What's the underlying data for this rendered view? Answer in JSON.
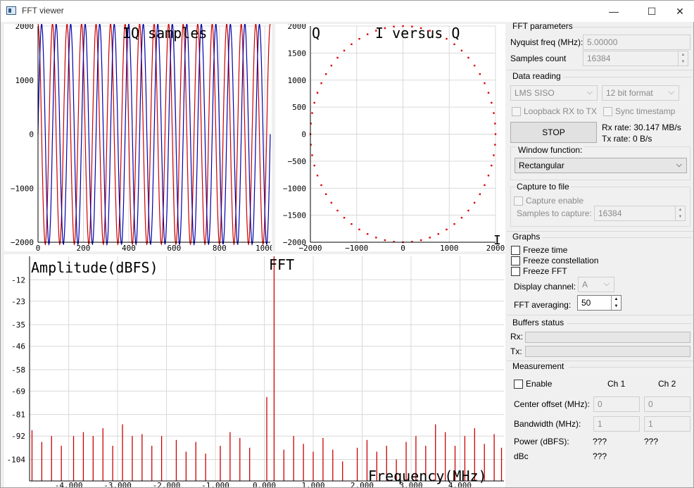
{
  "window": {
    "title": "FFT viewer",
    "minimize_glyph": "—",
    "maximize_glyph": "☐",
    "close_glyph": "✕"
  },
  "iq_plot": {
    "title": "IQ samples",
    "y_ticks": [
      "2000",
      "1000",
      "0",
      "−1000",
      "−2000"
    ],
    "x_ticks": [
      "0",
      "200",
      "400",
      "600",
      "800",
      "1000"
    ],
    "colors": {
      "i": "#cc0000",
      "q": "#0000aa"
    },
    "chart_data": {
      "type": "line",
      "title": "IQ samples",
      "xlim": [
        0,
        1024
      ],
      "ylim": [
        -2000,
        2000
      ],
      "cycles": 16,
      "amplitude": 2000,
      "series": [
        {
          "name": "I",
          "color": "#cc0000"
        },
        {
          "name": "Q",
          "color": "#0000aa"
        }
      ]
    }
  },
  "const_plot": {
    "title": "I versus Q",
    "corner_label": "Q",
    "x_end_label": "I",
    "y_ticks": [
      "2000",
      "1500",
      "1000",
      "500",
      "0",
      "−500",
      "−1000",
      "−1500",
      "−2000"
    ],
    "x_ticks": [
      "−2000",
      "−1000",
      "0",
      "1000",
      "2000"
    ],
    "color": "#dd0000",
    "chart_data": {
      "type": "scatter",
      "title": "I versus Q",
      "xlim": [
        -2000,
        2000
      ],
      "ylim": [
        -2000,
        2000
      ],
      "radius": 2000,
      "points": 64
    }
  },
  "fft_plot": {
    "title": "FFT",
    "ylabel": "Amplitude(dBFS)",
    "xlabel": "Frequency(MHz)",
    "y_ticks": [
      "-12",
      "-23",
      "-35",
      "-46",
      "-58",
      "-69",
      "-81",
      "-92",
      "-104"
    ],
    "x_ticks": [
      "-4.000",
      "-3.000",
      "-2.000",
      "-1.000",
      "0.000",
      "1.000",
      "2.000",
      "3.000",
      "4.000"
    ],
    "color": "#cc0000",
    "chart_data": {
      "type": "bar",
      "title": "FFT",
      "ylabel": "Amplitude(dBFS)",
      "xlabel": "Frequency(MHz)",
      "xlim": [
        -4.8,
        4.9
      ],
      "ylim": [
        -115,
        0
      ],
      "peaks": [
        {
          "f": 0.2,
          "db": 0
        },
        {
          "f": 0.05,
          "db": -72
        },
        {
          "f": -4.75,
          "db": -89
        },
        {
          "f": -4.55,
          "db": -95
        },
        {
          "f": -4.35,
          "db": -92
        },
        {
          "f": -4.15,
          "db": -97
        },
        {
          "f": -3.9,
          "db": -92
        },
        {
          "f": -3.7,
          "db": -90
        },
        {
          "f": -3.5,
          "db": -92
        },
        {
          "f": -3.3,
          "db": -88
        },
        {
          "f": -3.1,
          "db": -97
        },
        {
          "f": -2.9,
          "db": -86
        },
        {
          "f": -2.7,
          "db": -92
        },
        {
          "f": -2.5,
          "db": -91
        },
        {
          "f": -2.3,
          "db": -97
        },
        {
          "f": -2.1,
          "db": -92
        },
        {
          "f": -1.8,
          "db": -94
        },
        {
          "f": -1.6,
          "db": -100
        },
        {
          "f": -1.4,
          "db": -95
        },
        {
          "f": -1.2,
          "db": -101
        },
        {
          "f": -0.9,
          "db": -97
        },
        {
          "f": -0.7,
          "db": -90
        },
        {
          "f": -0.5,
          "db": -93
        },
        {
          "f": -0.3,
          "db": -98
        },
        {
          "f": 0.4,
          "db": -99
        },
        {
          "f": 0.6,
          "db": -92
        },
        {
          "f": 0.8,
          "db": -96
        },
        {
          "f": 1.0,
          "db": -100
        },
        {
          "f": 1.2,
          "db": -93
        },
        {
          "f": 1.4,
          "db": -99
        },
        {
          "f": 1.6,
          "db": -105
        },
        {
          "f": 1.9,
          "db": -98
        },
        {
          "f": 2.1,
          "db": -94
        },
        {
          "f": 2.3,
          "db": -100
        },
        {
          "f": 2.5,
          "db": -97
        },
        {
          "f": 2.7,
          "db": -104
        },
        {
          "f": 2.9,
          "db": -95
        },
        {
          "f": 3.1,
          "db": -92
        },
        {
          "f": 3.3,
          "db": -97
        },
        {
          "f": 3.5,
          "db": -86
        },
        {
          "f": 3.7,
          "db": -90
        },
        {
          "f": 3.9,
          "db": -97
        },
        {
          "f": 4.1,
          "db": -92
        },
        {
          "f": 4.3,
          "db": -88
        },
        {
          "f": 4.5,
          "db": -96
        },
        {
          "f": 4.7,
          "db": -91
        },
        {
          "f": 4.85,
          "db": -98
        }
      ]
    }
  },
  "panel": {
    "fft_params": {
      "title": "FFT parameters",
      "nyquist_label": "Nyquist freq (MHz):",
      "nyquist_value": "5.00000",
      "samples_label": "Samples count",
      "samples_value": "16384"
    },
    "data_reading": {
      "title": "Data reading",
      "mode": "LMS SISO",
      "format": "12 bit format",
      "loopback_label": "Loopback RX to TX",
      "sync_label": "Sync timestamp",
      "stop_label": "STOP",
      "rx_rate": "Rx rate:  30.147 MB/s",
      "tx_rate": "Tx rate:   0 B/s",
      "window_title": "Window function:",
      "window_value": "Rectangular",
      "capture_title": "Capture to file",
      "capture_enable_label": "Capture enable",
      "samples_to_capture_label": "Samples to capture:",
      "samples_to_capture_value": "16384"
    },
    "graphs": {
      "title": "Graphs",
      "freeze_time": "Freeze time",
      "freeze_constellation": "Freeze constellation",
      "freeze_fft": "Freeze FFT",
      "display_channel_label": "Display channel:",
      "display_channel_value": "A",
      "averaging_label": "FFT averaging:",
      "averaging_value": "50"
    },
    "buffers": {
      "title": "Buffers status",
      "rx_label": "Rx:",
      "tx_label": "Tx:"
    },
    "measurement": {
      "title": "Measurement",
      "enable_label": "Enable",
      "ch1": "Ch 1",
      "ch2": "Ch 2",
      "center_label": "Center offset (MHz):",
      "center_ch1": "0",
      "center_ch2": "0",
      "bw_label": "Bandwidth (MHz):",
      "bw_ch1": "1",
      "bw_ch2": "1",
      "power_label": "Power (dBFS):",
      "power_ch1": "???",
      "power_ch2": "???",
      "dbc_label": "dBc",
      "dbc_ch1": "???"
    }
  }
}
